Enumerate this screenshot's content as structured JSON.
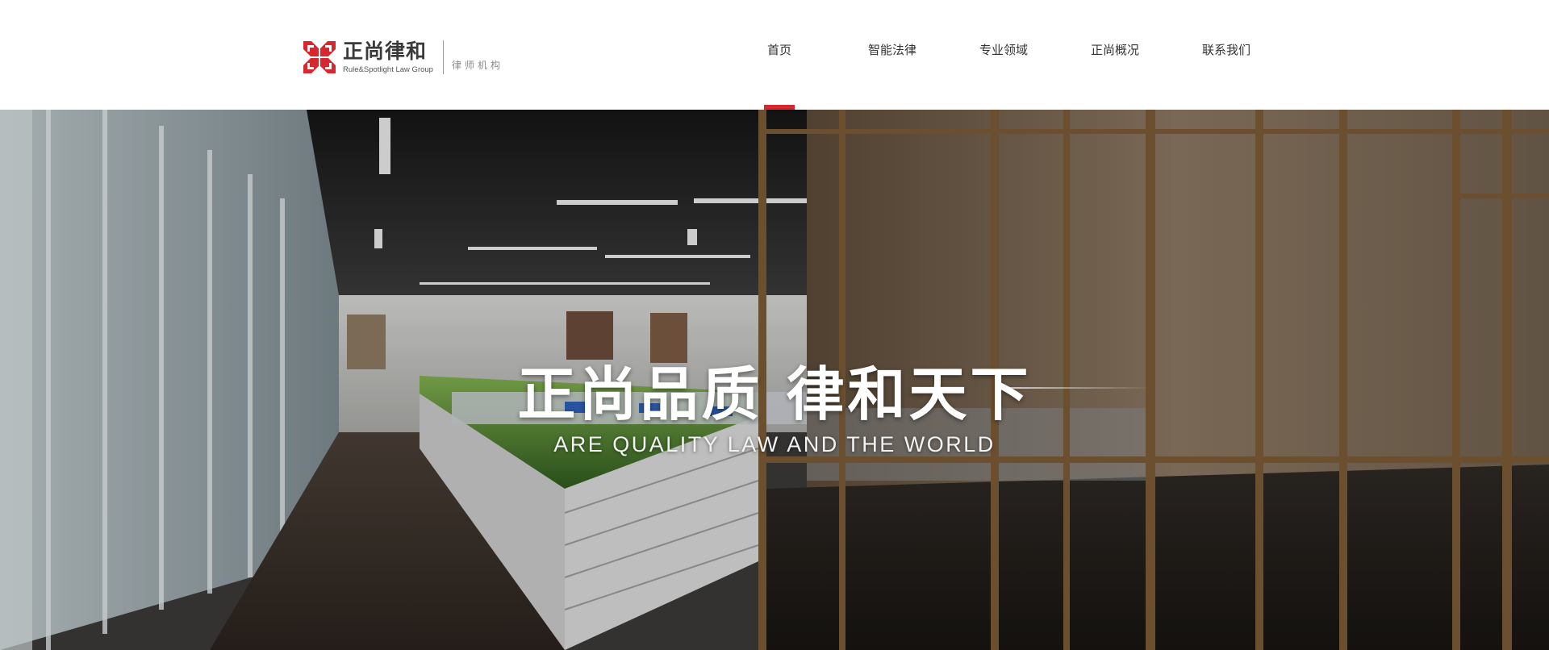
{
  "brand": {
    "name_cn": "正尚律和",
    "name_en": "Rule&Spotlight  Law Group",
    "subtitle": "律师机构",
    "logo_icon": "red-pinwheel-logo-icon",
    "accent_color": "#d7282f"
  },
  "nav": {
    "items": [
      {
        "label": "首页",
        "active": true
      },
      {
        "label": "智能法律",
        "active": false
      },
      {
        "label": "专业领域",
        "active": false
      },
      {
        "label": "正尚概况",
        "active": false
      },
      {
        "label": "联系我们",
        "active": false
      }
    ]
  },
  "hero": {
    "title": "正尚品质 律和天下",
    "subtitle": "ARE QUALITY LAW AND THE WORLD"
  }
}
